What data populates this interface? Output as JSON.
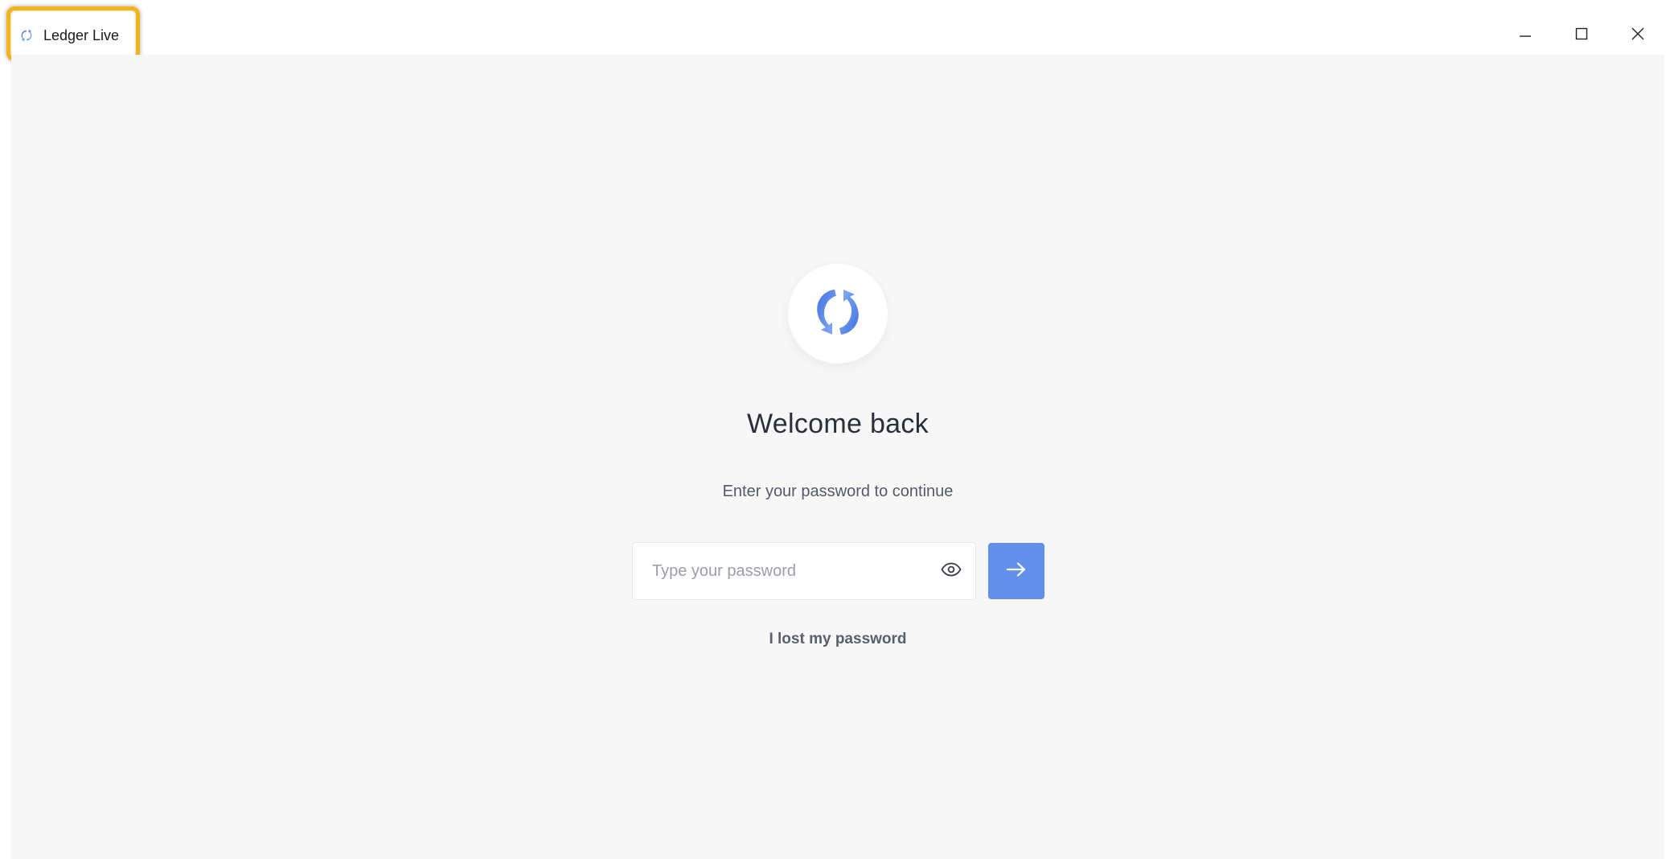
{
  "window": {
    "title": "Ledger Live",
    "app_icon": "ledger-live-logo-icon",
    "controls": {
      "minimize_icon": "minimize-icon",
      "maximize_icon": "maximize-icon",
      "close_icon": "close-icon"
    }
  },
  "login": {
    "logo_icon": "ledger-live-logo-icon",
    "heading": "Welcome back",
    "subtitle": "Enter your password to continue",
    "password_field": {
      "value": "",
      "placeholder": "Type your password",
      "toggle_icon": "eye-icon"
    },
    "submit_icon": "arrow-right-icon",
    "lost_password_label": "I lost my password"
  },
  "colors": {
    "accent": "#6390ea",
    "logo_gradient_start": "#3f6fe0",
    "logo_gradient_end": "#8cb2f5",
    "highlight_border": "#f5b31a",
    "background": "#f7f7f7"
  }
}
